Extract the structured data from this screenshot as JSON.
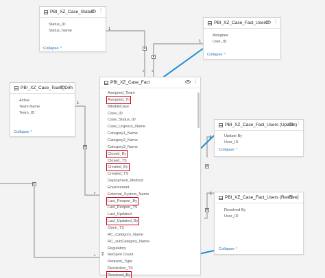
{
  "tables": {
    "case_status": {
      "title": "PBI_XZ_Case_Status",
      "fields": [
        "Status_ID",
        "Status_Name"
      ],
      "collapse": "Collapse"
    },
    "case_fact_users": {
      "title": "PBI_XZ_Case_Fact_Users",
      "fields": [
        "Assignee",
        "User_ID"
      ],
      "collapse": "Collapse"
    },
    "case_team_dim": {
      "title": "PBI_XZ_Case_Team_Dim",
      "fields": [
        "Active",
        "Team Name",
        "Team_ID"
      ],
      "collapse": "Collapse"
    },
    "case_fact": {
      "title": "PBI_XZ_Case_Fact",
      "fields": [
        "Assigned_Team",
        "Assigned_To",
        "BillableCase",
        "Case_ID",
        "Case_Status_ID",
        "Case_Urgency_Name",
        "Category1_Name",
        "Category2_Name",
        "Category3_Name",
        "Closed_By",
        "Closed_TS",
        "Created_By",
        "Created_TS",
        "Deployment_Method",
        "Environment",
        "External_System_Name",
        "Last_Reopen_By",
        "Last_Reopen_TS",
        "Last_Updated",
        "Last_Updated_By",
        "Open_TS",
        "RC_Category_Name",
        "RC_subCategory_Name",
        "Regulatory",
        "ReOpen Count",
        "Request_Type",
        "Resolution_TS",
        "Resolved_By"
      ],
      "highlighted": [
        "Assigned_To",
        "Closed_By",
        "Created_By",
        "Last_Reopen_By",
        "Last_Updated_By",
        "Resolved_By"
      ],
      "measure_field": "ReOpen Count"
    },
    "case_fact_users_update": {
      "title": "PBI_XZ_Case_Fact_Users (Update)",
      "fields": [
        "Update By",
        "User_ID"
      ],
      "collapse": "Collapse"
    },
    "case_fact_users_resolve": {
      "title": "PBI_XZ_Case_Fact_Users (Resolve)",
      "fields": [
        "Resolved By",
        "User_ID"
      ],
      "collapse": "Collapse"
    }
  },
  "cardinality": {
    "one": "1",
    "many": "*"
  },
  "icons": [
    "table-icon",
    "eye-icon",
    "more-options-icon",
    "chevron-up-icon",
    "sigma-icon",
    "relationship-filter-icon"
  ],
  "colors": {
    "highlight": "#d0021b",
    "connector": "#1a8fd6",
    "link": "#2d6fb5"
  }
}
